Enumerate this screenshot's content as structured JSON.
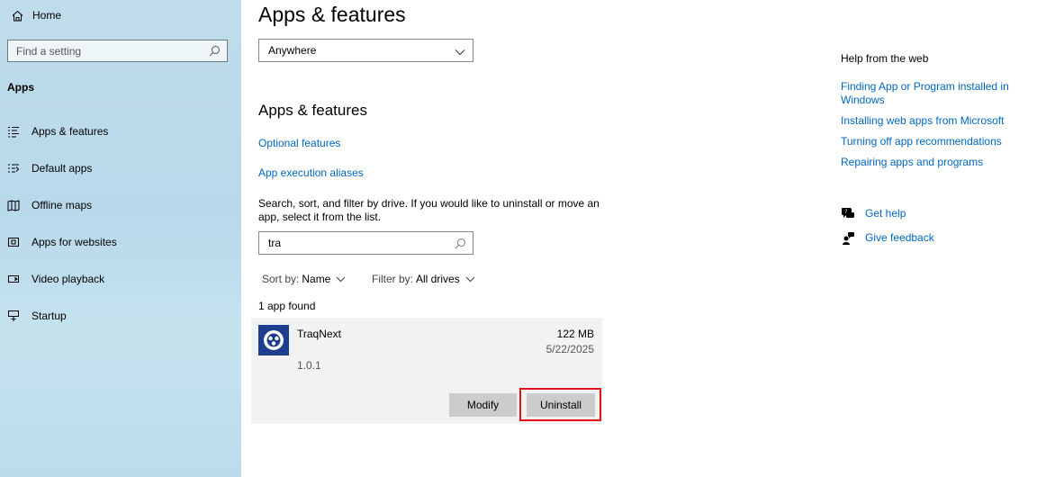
{
  "sidebar": {
    "home_label": "Home",
    "search_placeholder": "Find a setting",
    "section": "Apps",
    "items": [
      {
        "label": "Apps & features",
        "icon": "list-icon"
      },
      {
        "label": "Default apps",
        "icon": "default-apps-icon"
      },
      {
        "label": "Offline maps",
        "icon": "map-icon"
      },
      {
        "label": "Apps for websites",
        "icon": "web-apps-icon"
      },
      {
        "label": "Video playback",
        "icon": "video-icon"
      },
      {
        "label": "Startup",
        "icon": "startup-icon"
      }
    ]
  },
  "main": {
    "title": "Apps & features",
    "install_dropdown": "Anywhere",
    "subtitle": "Apps & features",
    "optional_features": "Optional features",
    "execution_aliases": "App execution aliases",
    "description": "Search, sort, and filter by drive. If you would like to uninstall or move an app, select it from the list.",
    "search_value": "tra",
    "sort_label": "Sort by:",
    "sort_value": "Name",
    "filter_label": "Filter by:",
    "filter_value": "All drives",
    "result_count": "1 app found",
    "app": {
      "name": "TraqNext",
      "version": "1.0.1",
      "size": "122 MB",
      "date": "5/22/2025",
      "modify_label": "Modify",
      "uninstall_label": "Uninstall"
    }
  },
  "help": {
    "title": "Help from the web",
    "links": [
      "Finding App or Program installed in Windows",
      "Installing web apps from Microsoft",
      "Turning off app recommendations",
      "Repairing apps and programs"
    ],
    "get_help": "Get help",
    "give_feedback": "Give feedback"
  },
  "colors": {
    "link": "#0067c0",
    "highlight": "#e3121a",
    "sidebar_bg": "#bfdcea"
  }
}
